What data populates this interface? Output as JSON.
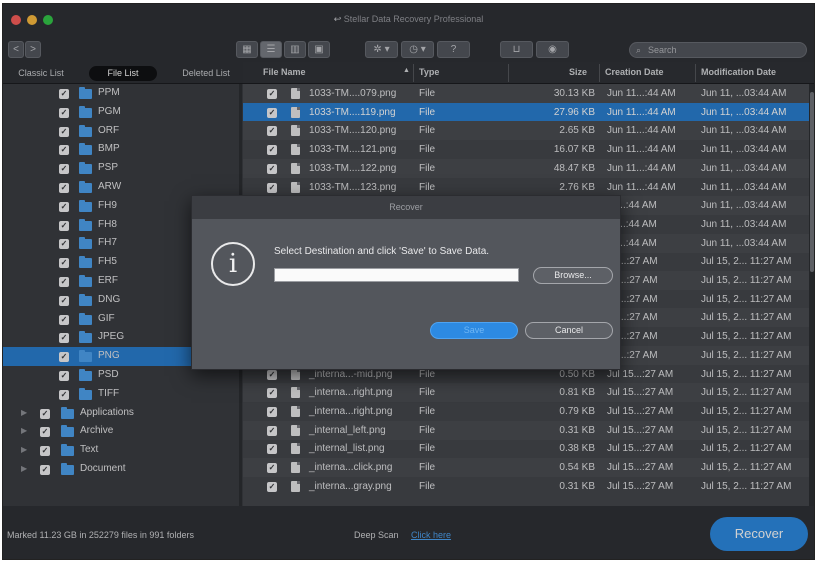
{
  "app": {
    "title": "Stellar Data Recovery Professional"
  },
  "toolbar": {
    "back": "<",
    "forward": ">",
    "help": "?",
    "search_placeholder": "Search"
  },
  "tabs": [
    "Classic List",
    "File List",
    "Deleted List"
  ],
  "tree": [
    {
      "label": "PPM"
    },
    {
      "label": "PGM"
    },
    {
      "label": "ORF"
    },
    {
      "label": "BMP"
    },
    {
      "label": "PSP"
    },
    {
      "label": "ARW"
    },
    {
      "label": "FH9"
    },
    {
      "label": "FH8"
    },
    {
      "label": "FH7"
    },
    {
      "label": "FH5"
    },
    {
      "label": "ERF"
    },
    {
      "label": "DNG"
    },
    {
      "label": "GIF"
    },
    {
      "label": "JPEG"
    },
    {
      "label": "PNG"
    },
    {
      "label": "PSD"
    },
    {
      "label": "TIFF"
    },
    {
      "label": "Applications"
    },
    {
      "label": "Archive"
    },
    {
      "label": "Text"
    },
    {
      "label": "Document"
    }
  ],
  "columns": [
    "File Name",
    "Type",
    "Size",
    "Creation Date",
    "Modification Date"
  ],
  "rows": [
    {
      "name": "1033-TM....079.png",
      "type": "File",
      "size": "30.13 KB",
      "created": "Jun 11...:44 AM",
      "modified": "Jun 11, ...03:44 AM"
    },
    {
      "name": "1033-TM....119.png",
      "type": "File",
      "size": "27.96 KB",
      "created": "Jun 11...:44 AM",
      "modified": "Jun 11, ...03:44 AM"
    },
    {
      "name": "1033-TM....120.png",
      "type": "File",
      "size": "2.65 KB",
      "created": "Jun 11...:44 AM",
      "modified": "Jun 11, ...03:44 AM"
    },
    {
      "name": "1033-TM....121.png",
      "type": "File",
      "size": "16.07 KB",
      "created": "Jun 11...:44 AM",
      "modified": "Jun 11, ...03:44 AM"
    },
    {
      "name": "1033-TM....122.png",
      "type": "File",
      "size": "48.47 KB",
      "created": "Jun 11...:44 AM",
      "modified": "Jun 11, ...03:44 AM"
    },
    {
      "name": "1033-TM....123.png",
      "type": "File",
      "size": "2.76 KB",
      "created": "Jun 11...:44 AM",
      "modified": "Jun 11, ...03:44 AM"
    },
    {
      "name": "",
      "type": "",
      "size": "",
      "created": "11...:44 AM",
      "modified": "Jun 11, ...03:44 AM"
    },
    {
      "name": "",
      "type": "",
      "size": "",
      "created": "11...:44 AM",
      "modified": "Jun 11, ...03:44 AM"
    },
    {
      "name": "",
      "type": "",
      "size": "",
      "created": "11...:44 AM",
      "modified": "Jun 11, ...03:44 AM"
    },
    {
      "name": "",
      "type": "",
      "size": "",
      "created": "15...:27 AM",
      "modified": "Jul 15, 2... 11:27 AM"
    },
    {
      "name": "",
      "type": "",
      "size": "",
      "created": "15...:27 AM",
      "modified": "Jul 15, 2... 11:27 AM"
    },
    {
      "name": "",
      "type": "",
      "size": "",
      "created": "15...:27 AM",
      "modified": "Jul 15, 2... 11:27 AM"
    },
    {
      "name": "",
      "type": "",
      "size": "",
      "created": "15...:27 AM",
      "modified": "Jul 15, 2... 11:27 AM"
    },
    {
      "name": "",
      "type": "",
      "size": "",
      "created": "15...:27 AM",
      "modified": "Jul 15, 2... 11:27 AM"
    },
    {
      "name": "",
      "type": "",
      "size": "",
      "created": "15...:27 AM",
      "modified": "Jul 15, 2... 11:27 AM"
    },
    {
      "name": "_interna...-mid.png",
      "type": "File",
      "size": "0.50 KB",
      "created": "Jul 15...:27 AM",
      "modified": "Jul 15, 2... 11:27 AM"
    },
    {
      "name": "_interna...right.png",
      "type": "File",
      "size": "0.81 KB",
      "created": "Jul 15...:27 AM",
      "modified": "Jul 15, 2... 11:27 AM"
    },
    {
      "name": "_interna...right.png",
      "type": "File",
      "size": "0.79 KB",
      "created": "Jul 15...:27 AM",
      "modified": "Jul 15, 2... 11:27 AM"
    },
    {
      "name": "_internal_left.png",
      "type": "File",
      "size": "0.31 KB",
      "created": "Jul 15...:27 AM",
      "modified": "Jul 15, 2... 11:27 AM"
    },
    {
      "name": "_internal_list.png",
      "type": "File",
      "size": "0.38 KB",
      "created": "Jul 15...:27 AM",
      "modified": "Jul 15, 2... 11:27 AM"
    },
    {
      "name": "_interna...click.png",
      "type": "File",
      "size": "0.54 KB",
      "created": "Jul 15...:27 AM",
      "modified": "Jul 15, 2... 11:27 AM"
    },
    {
      "name": "_interna...gray.png",
      "type": "File",
      "size": "0.31 KB",
      "created": "Jul 15...:27 AM",
      "modified": "Jul 15, 2... 11:27 AM"
    }
  ],
  "status": {
    "marked": "Marked 11.23 GB in 252279 files in 991 folders",
    "deep_scan": "Deep Scan",
    "click_here": "Click here",
    "recover": "Recover"
  },
  "dialog": {
    "title": "Recover",
    "message": "Select Destination and click 'Save' to Save Data.",
    "path_value": "",
    "browse": "Browse...",
    "save": "Save",
    "cancel": "Cancel",
    "icon": "info-icon"
  },
  "colors": {
    "accent": "#2a7fd1",
    "folder": "#4fa3f0",
    "recover_button": "#2d8ae2"
  }
}
